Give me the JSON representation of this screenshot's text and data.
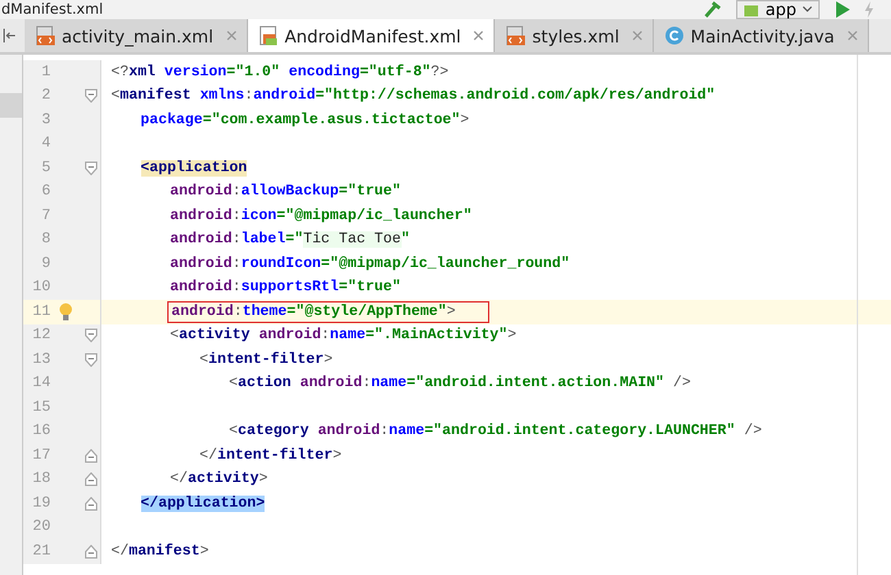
{
  "breadcrumb": "dManifest.xml",
  "toolbar": {
    "run_config": "app"
  },
  "tabs": [
    {
      "label": "activity_main.xml",
      "selected": false,
      "kind": "xml"
    },
    {
      "label": "AndroidManifest.xml",
      "selected": true,
      "kind": "manifest"
    },
    {
      "label": "styles.xml",
      "selected": false,
      "kind": "xml"
    },
    {
      "label": "MainActivity.java",
      "selected": false,
      "kind": "class"
    }
  ],
  "editor": {
    "lines": [
      {
        "number": "1",
        "tokens": [
          {
            "kind": "punct",
            "text": "<?"
          },
          {
            "kind": "tag",
            "text": "xml "
          },
          {
            "kind": "attr",
            "text": "version"
          },
          {
            "kind": "value",
            "text": "=\"1.0\" "
          },
          {
            "kind": "attr",
            "text": "encoding"
          },
          {
            "kind": "value",
            "text": "=\"utf-8\""
          },
          {
            "kind": "punct",
            "text": "?>"
          }
        ]
      },
      {
        "number": "2",
        "fold_start": true,
        "tokens": [
          {
            "kind": "punct",
            "text": "<"
          },
          {
            "kind": "tag",
            "text": "manifest "
          },
          {
            "kind": "attr",
            "text": "xmlns"
          },
          {
            "kind": "punct",
            "text": ":"
          },
          {
            "kind": "attr",
            "text": "android"
          },
          {
            "kind": "value",
            "text": "=\"http://schemas.android.com/apk/res/android\""
          }
        ],
        "children": [
          {
            "number": "3",
            "tokens": [
              {
                "kind": "attr",
                "text": "package"
              },
              {
                "kind": "value",
                "text": "=\"com.example.asus.tictactoe\""
              },
              {
                "kind": "punct",
                "text": ">"
              }
            ]
          },
          {
            "number": "4"
          },
          {
            "number": "5",
            "fold_start": true,
            "tokens": [
              {
                "kind": "tag",
                "text": "<application",
                "matched": true
              }
            ],
            "children": [
              {
                "number": "6",
                "tokens": [
                  {
                    "kind": "ns",
                    "text": "android"
                  },
                  {
                    "kind": "punct",
                    "text": ":"
                  },
                  {
                    "kind": "attr",
                    "text": "allowBackup"
                  },
                  {
                    "kind": "value",
                    "text": "=\"true\""
                  }
                ]
              },
              {
                "number": "7",
                "tokens": [
                  {
                    "kind": "ns",
                    "text": "android"
                  },
                  {
                    "kind": "punct",
                    "text": ":"
                  },
                  {
                    "kind": "attr",
                    "text": "icon"
                  },
                  {
                    "kind": "value",
                    "text": "=\"@mipmap/ic_launcher\""
                  }
                ]
              },
              {
                "number": "8",
                "tokens": [
                  {
                    "kind": "ns",
                    "text": "android"
                  },
                  {
                    "kind": "punct",
                    "text": ":"
                  },
                  {
                    "kind": "attr",
                    "text": "label"
                  },
                  {
                    "kind": "value",
                    "text": "=\""
                  },
                  {
                    "kind": "plain",
                    "text": "Tic Tac Toe",
                    "injected": true
                  },
                  {
                    "kind": "value",
                    "text": "\""
                  }
                ]
              },
              {
                "number": "9",
                "tokens": [
                  {
                    "kind": "ns",
                    "text": "android"
                  },
                  {
                    "kind": "punct",
                    "text": ":"
                  },
                  {
                    "kind": "attr",
                    "text": "roundIcon"
                  },
                  {
                    "kind": "value",
                    "text": "=\"@mipmap/ic_launcher_round\""
                  }
                ]
              },
              {
                "number": "10",
                "tokens": [
                  {
                    "kind": "ns",
                    "text": "android"
                  },
                  {
                    "kind": "punct",
                    "text": ":"
                  },
                  {
                    "kind": "attr",
                    "text": "supportsRtl"
                  },
                  {
                    "kind": "value",
                    "text": "=\"true\""
                  }
                ]
              },
              {
                "number": "11",
                "caret_line": true,
                "boxed": true,
                "bulb": true,
                "tokens": [
                  {
                    "kind": "ns",
                    "text": "android"
                  },
                  {
                    "kind": "punct",
                    "text": ":"
                  },
                  {
                    "kind": "attr",
                    "text": "theme"
                  },
                  {
                    "kind": "value",
                    "text": "=\"@style/AppTheme\""
                  },
                  {
                    "kind": "punct",
                    "text": ">"
                  }
                ]
              },
              {
                "number": "12",
                "fold_start": true,
                "tokens": [
                  {
                    "kind": "punct",
                    "text": "<"
                  },
                  {
                    "kind": "tag",
                    "text": "activity "
                  },
                  {
                    "kind": "ns",
                    "text": "android"
                  },
                  {
                    "kind": "punct",
                    "text": ":"
                  },
                  {
                    "kind": "attr",
                    "text": "name"
                  },
                  {
                    "kind": "value",
                    "text": "=\".MainActivity\""
                  },
                  {
                    "kind": "punct",
                    "text": ">"
                  }
                ],
                "children": [
                  {
                    "number": "13",
                    "fold_start": true,
                    "tokens": [
                      {
                        "kind": "punct",
                        "text": "<"
                      },
                      {
                        "kind": "tag",
                        "text": "intent-filter"
                      },
                      {
                        "kind": "punct",
                        "text": ">"
                      }
                    ],
                    "children": [
                      {
                        "number": "14",
                        "tokens": [
                          {
                            "kind": "punct",
                            "text": "<"
                          },
                          {
                            "kind": "tag",
                            "text": "action "
                          },
                          {
                            "kind": "ns",
                            "text": "android"
                          },
                          {
                            "kind": "punct",
                            "text": ":"
                          },
                          {
                            "kind": "attr",
                            "text": "name"
                          },
                          {
                            "kind": "value",
                            "text": "=\"android.intent.action.MAIN\""
                          },
                          {
                            "kind": "punct",
                            "text": " />"
                          }
                        ]
                      },
                      {
                        "number": "15"
                      },
                      {
                        "number": "16",
                        "tokens": [
                          {
                            "kind": "punct",
                            "text": "<"
                          },
                          {
                            "kind": "tag",
                            "text": "category "
                          },
                          {
                            "kind": "ns",
                            "text": "android"
                          },
                          {
                            "kind": "punct",
                            "text": ":"
                          },
                          {
                            "kind": "attr",
                            "text": "name"
                          },
                          {
                            "kind": "value",
                            "text": "=\"android.intent.category.LAUNCHER\""
                          },
                          {
                            "kind": "punct",
                            "text": " />"
                          }
                        ]
                      }
                    ]
                  },
                  {
                    "number": "17",
                    "fold_end": true,
                    "tokens": [
                      {
                        "kind": "punct",
                        "text": "</"
                      },
                      {
                        "kind": "tag",
                        "text": "intent-filter"
                      },
                      {
                        "kind": "punct",
                        "text": ">"
                      }
                    ]
                  }
                ]
              },
              {
                "number": "18",
                "fold_end": true,
                "tokens": [
                  {
                    "kind": "punct",
                    "text": "</"
                  },
                  {
                    "kind": "tag",
                    "text": "activity"
                  },
                  {
                    "kind": "punct",
                    "text": ">"
                  }
                ]
              }
            ]
          },
          {
            "number": "19",
            "fold_end": true,
            "tokens": [
              {
                "kind": "tag",
                "text": "</application>",
                "selected": true
              }
            ]
          },
          {
            "number": "20"
          }
        ]
      },
      {
        "number": "21",
        "fold_end": true,
        "tokens": [
          {
            "kind": "punct",
            "text": "</"
          },
          {
            "kind": "tag",
            "text": "manifest"
          },
          {
            "kind": "punct",
            "text": ">"
          }
        ]
      }
    ]
  }
}
